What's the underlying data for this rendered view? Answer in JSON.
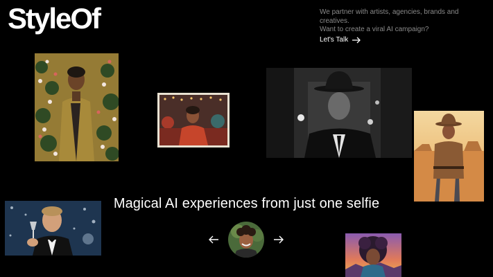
{
  "brand": {
    "logo_text": "StyleOf"
  },
  "pitch": {
    "line1": "We partner with artists, agencies, brands and creatives.",
    "line2": "Want to create a viral AI campaign?",
    "cta_label": "Let's Talk",
    "cta_icon": "arrow-right-icon"
  },
  "hero": {
    "tagline": "Magical AI experiences from just one selfie",
    "prev_icon": "arrow-left-icon",
    "next_icon": "arrow-right-icon"
  },
  "gallery": {
    "items": [
      {
        "style": "floral-painting-portrait",
        "palette": "#c9a54a"
      },
      {
        "style": "festival-photo-portrait",
        "palette": "#c6452b"
      },
      {
        "style": "noir-detective-portrait",
        "palette": "#6b6b6b"
      },
      {
        "style": "cowboy-desert-portrait",
        "palette": "#d9a55d"
      },
      {
        "style": "gatsby-toast-portrait",
        "palette": "#2f4a6b"
      },
      {
        "style": "psychedelic-afro-portrait",
        "palette": "#8a5bb0"
      }
    ]
  }
}
